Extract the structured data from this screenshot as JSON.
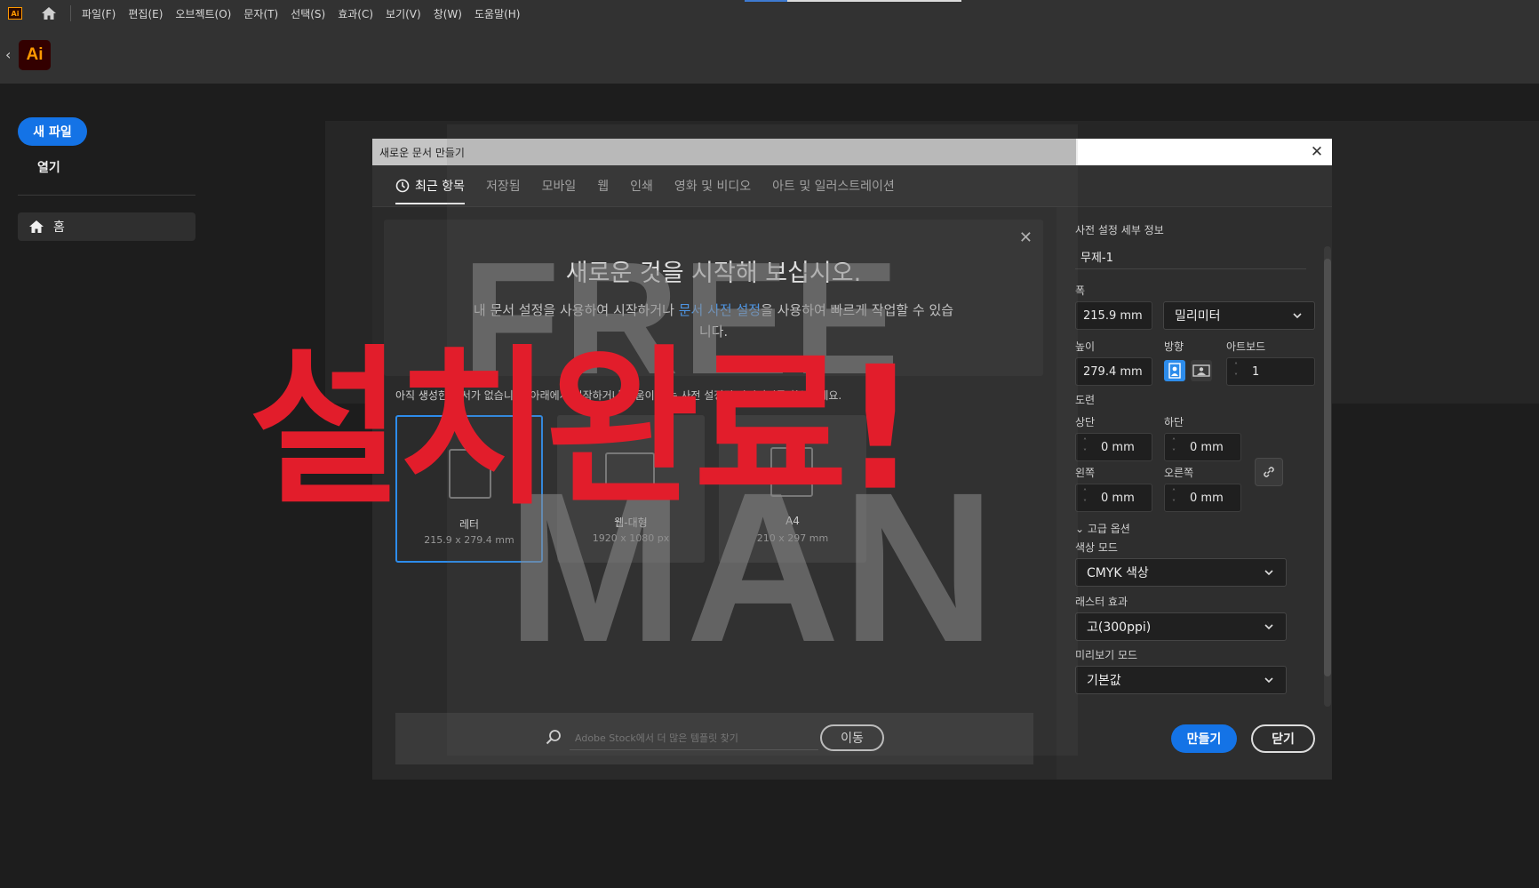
{
  "menubar": {
    "app_icon": "Ai",
    "items": [
      "파일(F)",
      "편집(E)",
      "오브젝트(O)",
      "문자(T)",
      "선택(S)",
      "효과(C)",
      "보기(V)",
      "창(W)",
      "도움말(H)"
    ]
  },
  "appbar": {
    "logo": "Ai"
  },
  "sidebar": {
    "new_file": "새 파일",
    "open": "열기",
    "home": "홈"
  },
  "dialog": {
    "title": "새로운 문서 만들기",
    "tabs": [
      "최근 항목",
      "저장됨",
      "모바일",
      "웹",
      "인쇄",
      "영화 및 비디오",
      "아트 및 일러스트레이션"
    ],
    "welcome": {
      "title": "새로운 것을 시작해 보십시오.",
      "desc_before": "내 문서 설정을 사용하여 시작하거나 ",
      "desc_link": "문서 사전 설정",
      "desc_after": "을 사용하여 빠르게 작업할 수 있습니다."
    },
    "hint": "아직 생성한 문서가 없습니다. 아래에서 시작하거나 도움이 되는 사전 설정된 아이디어를 확인하세요.",
    "presets": [
      {
        "name": "레터",
        "size": "215.9 x 279.4 mm"
      },
      {
        "name": "웹-대형",
        "size": "1920 x 1080 px"
      },
      {
        "name": "A4",
        "size": "210 x 297 mm"
      }
    ],
    "search": {
      "placeholder": "Adobe Stock에서 더 많은 템플릿 찾기",
      "go": "이동"
    }
  },
  "settings": {
    "section_title": "사전 설정 세부 정보",
    "doc_name": "무제-1",
    "width_label": "폭",
    "width_value": "215.9 mm",
    "unit": "밀리미터",
    "height_label": "높이",
    "height_value": "279.4 mm",
    "orientation_label": "방향",
    "artboard_label": "아트보드",
    "artboard_value": "1",
    "bleed_label": "도련",
    "top_label": "상단",
    "top_value": "0 mm",
    "bottom_label": "하단",
    "bottom_value": "0 mm",
    "left_label": "왼쪽",
    "left_value": "0 mm",
    "right_label": "오른쪽",
    "right_value": "0 mm",
    "advanced_label": "고급 옵션",
    "color_mode_label": "색상 모드",
    "color_mode_value": "CMYK 색상",
    "raster_label": "래스터 효과",
    "raster_value": "고(300ppi)",
    "preview_label": "미리보기 모드",
    "preview_value": "기본값",
    "create": "만들기",
    "close": "닫기"
  },
  "watermarks": {
    "text_top": "FREE",
    "text_bottom": "MAN",
    "red_text": "설치완료!"
  },
  "colors": {
    "accent": "#1473e6",
    "link": "#4b9cf5",
    "watermark_red": "#e21d2b"
  }
}
